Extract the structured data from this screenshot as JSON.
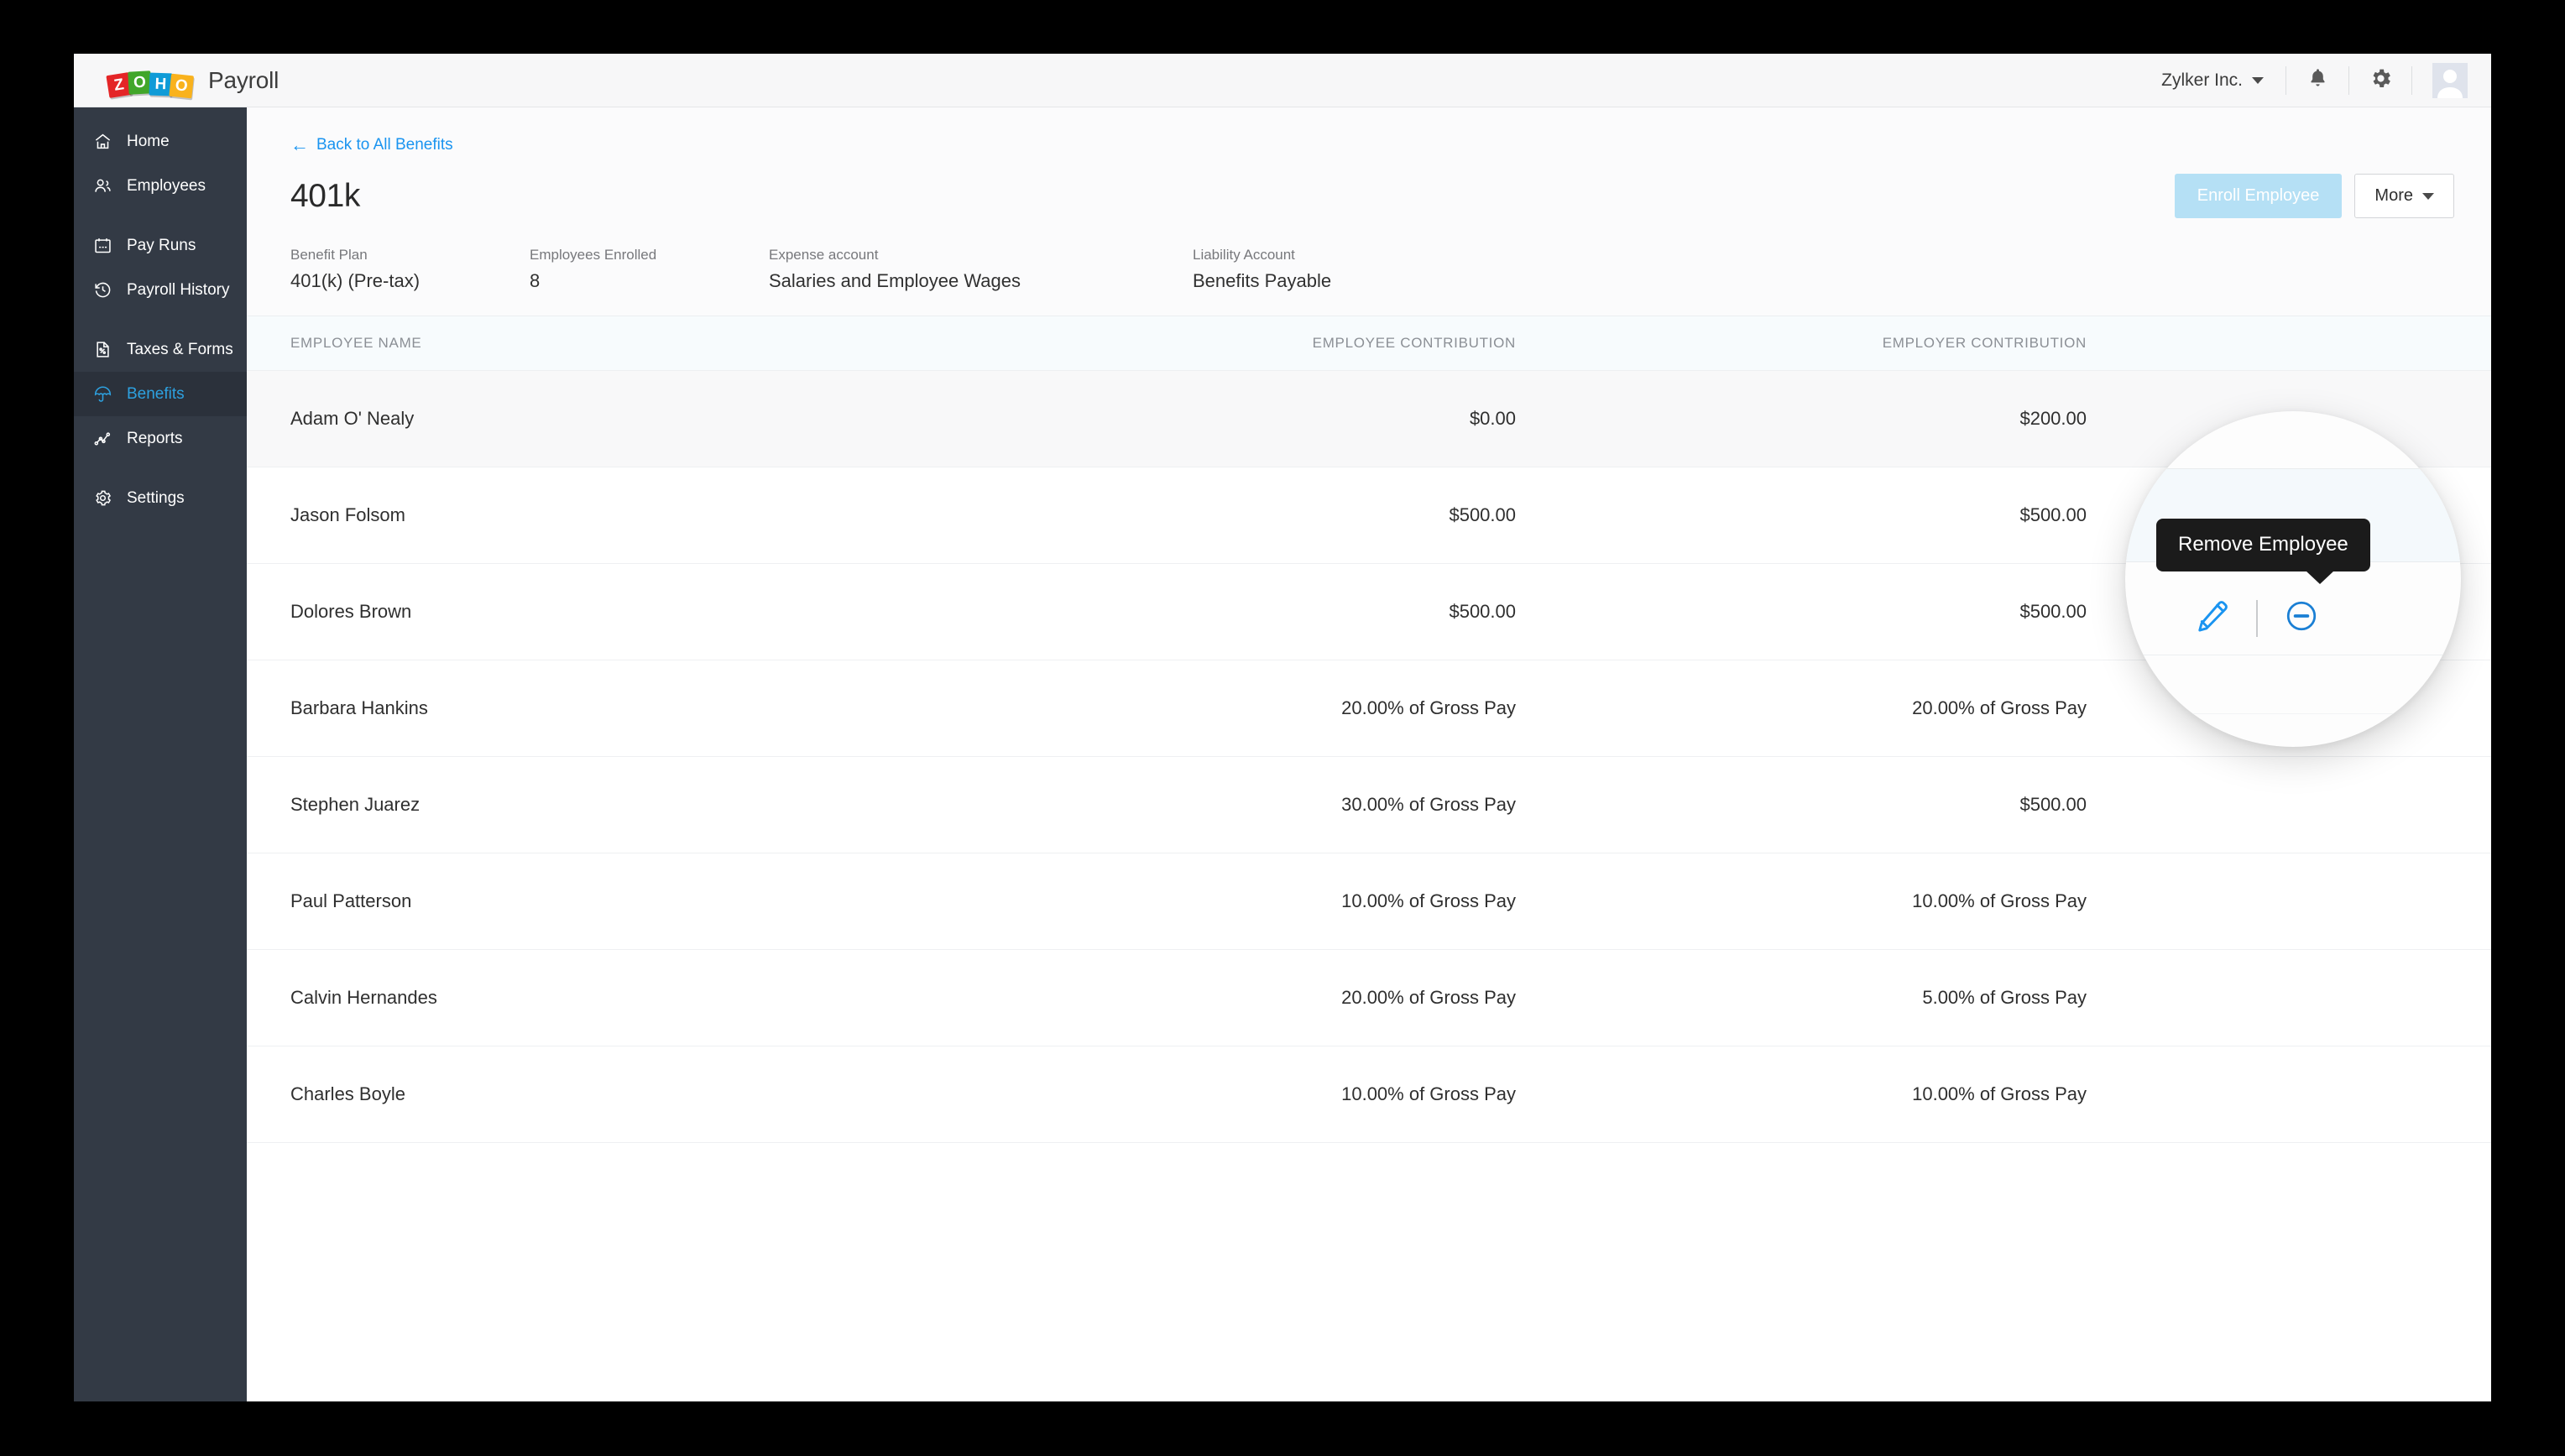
{
  "brand": {
    "logo_letters": [
      "Z",
      "O",
      "H",
      "O"
    ],
    "product": "Payroll"
  },
  "topbar": {
    "org_name": "Zylker Inc.",
    "notifications_icon": "bell-icon",
    "settings_icon": "gear-icon",
    "avatar_icon": "user-avatar"
  },
  "sidebar": {
    "items": [
      {
        "label": "Home",
        "icon": "home-icon",
        "active": false
      },
      {
        "label": "Employees",
        "icon": "people-icon",
        "active": false
      },
      {
        "label": "Pay Runs",
        "icon": "calendar-icon",
        "active": false
      },
      {
        "label": "Payroll History",
        "icon": "history-clock-icon",
        "active": false
      },
      {
        "label": "Taxes & Forms",
        "icon": "tax-document-icon",
        "active": false
      },
      {
        "label": "Benefits",
        "icon": "umbrella-icon",
        "active": true
      },
      {
        "label": "Reports",
        "icon": "line-chart-icon",
        "active": false
      },
      {
        "label": "Settings",
        "icon": "gear-icon",
        "active": false
      }
    ]
  },
  "page": {
    "back_link": "Back to All Benefits",
    "back_icon": "arrow-left-icon",
    "title": "401k",
    "enroll_button": "Enroll Employee",
    "more_button": "More",
    "more_caret_icon": "chevron-down-icon"
  },
  "meta": {
    "benefit_plan_label": "Benefit Plan",
    "benefit_plan_value": "401(k) (Pre-tax)",
    "employees_enrolled_label": "Employees Enrolled",
    "employees_enrolled_value": "8",
    "expense_account_label": "Expense account",
    "expense_account_value": "Salaries and Employee Wages",
    "liability_account_label": "Liability Account",
    "liability_account_value": "Benefits Payable"
  },
  "table": {
    "columns": [
      "EMPLOYEE NAME",
      "EMPLOYEE CONTRIBUTION",
      "EMPLOYER CONTRIBUTION"
    ],
    "rows": [
      {
        "name": "Adam O' Nealy",
        "employee_contribution": "$0.00",
        "employer_contribution": "$200.00"
      },
      {
        "name": "Jason Folsom",
        "employee_contribution": "$500.00",
        "employer_contribution": "$500.00"
      },
      {
        "name": "Dolores Brown",
        "employee_contribution": "$500.00",
        "employer_contribution": "$500.00"
      },
      {
        "name": "Barbara Hankins",
        "employee_contribution": "20.00% of Gross Pay",
        "employer_contribution": "20.00% of Gross Pay"
      },
      {
        "name": "Stephen Juarez",
        "employee_contribution": "30.00% of Gross Pay",
        "employer_contribution": "$500.00"
      },
      {
        "name": "Paul Patterson",
        "employee_contribution": "10.00% of Gross Pay",
        "employer_contribution": "10.00% of Gross Pay"
      },
      {
        "name": "Calvin Hernandes",
        "employee_contribution": "20.00% of Gross Pay",
        "employer_contribution": "5.00% of Gross Pay"
      },
      {
        "name": "Charles Boyle",
        "employee_contribution": "10.00% of Gross Pay",
        "employer_contribution": "10.00% of Gross Pay"
      }
    ]
  },
  "magnifier": {
    "tooltip": "Remove Employee",
    "edit_icon": "pencil-edit-icon",
    "remove_icon": "minus-circle-icon"
  },
  "colors": {
    "accent": "#1a94f0",
    "sidebar_bg": "#333a45",
    "sidebar_active_text": "#2da1e0",
    "enroll_button_bg": "#b5e0f5",
    "tooltip_bg": "#1b1b1b"
  }
}
